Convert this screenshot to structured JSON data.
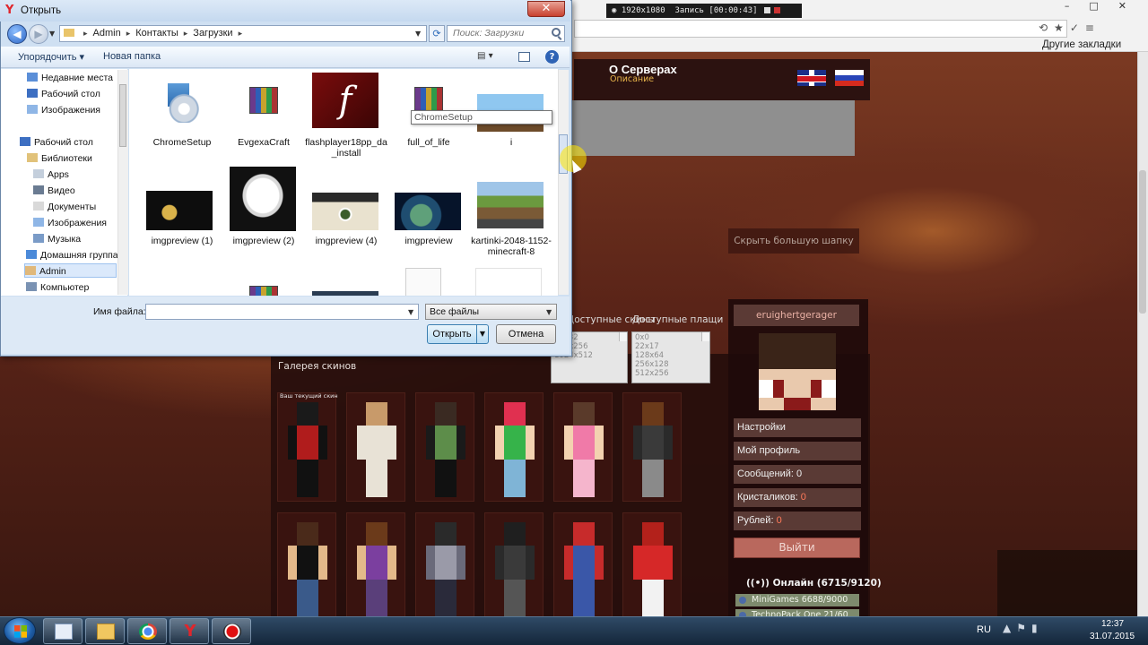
{
  "recorder": {
    "resolution": "1920x1080",
    "status": "Запись [00:00:43]"
  },
  "browser": {
    "other_bookmarks": "Другие закладки"
  },
  "site": {
    "about_title": "О Серверах",
    "about_subtitle": "Описание",
    "hide_header": "Скрыть большую шапку",
    "available_skins": "Доступные скины",
    "available_capes": "Доступные плащи",
    "skin_sizes": [
      "64x32",
      "512x256",
      "1024x512"
    ],
    "cape_sizes": [
      "0x0",
      "22x17",
      "128x64",
      "256x128",
      "512x256"
    ],
    "gallery_title": "Галерея скинов",
    "current_skin_label": "Ваш текущий скин",
    "skins": [
      {
        "name": "skin-1",
        "head": "#1a1a1a",
        "torso": "#b01c1c",
        "arms": "#111111",
        "legs": "#111111"
      },
      {
        "name": "skin-2",
        "head": "#c89a6a",
        "torso": "#e8e2d6",
        "arms": "#e8e2d6",
        "legs": "#e8e2d6"
      },
      {
        "name": "skin-3",
        "head": "#3a2a22",
        "torso": "#5d8d4a",
        "arms": "#1a1a1a",
        "legs": "#111111"
      },
      {
        "name": "skin-4",
        "head": "#e03050",
        "torso": "#36b34a",
        "arms": "#f3d2b0",
        "legs": "#7fb4d6"
      },
      {
        "name": "skin-5",
        "head": "#5a3a2a",
        "torso": "#f07aa8",
        "arms": "#f3d2b0",
        "legs": "#f5b5cc"
      },
      {
        "name": "skin-6",
        "head": "#6b3a1a",
        "torso": "#3a3a3a",
        "arms": "#2a2a2a",
        "legs": "#8a8a8a"
      },
      {
        "name": "skin-7",
        "head": "#4a2a1a",
        "torso": "#111111",
        "arms": "#e3b98a",
        "legs": "#3a5a8a"
      },
      {
        "name": "skin-8",
        "head": "#6b3a1a",
        "torso": "#7b3f9f",
        "arms": "#e3b98a",
        "legs": "#5a3f7a"
      },
      {
        "name": "skin-9",
        "head": "#2a2a2a",
        "torso": "#9a9aa8",
        "arms": "#6a6a7a",
        "legs": "#2a2a3a"
      },
      {
        "name": "skin-10",
        "head": "#1f1f1f",
        "torso": "#3a3a3a",
        "arms": "#2a2a2a",
        "legs": "#555555"
      },
      {
        "name": "skin-11",
        "head": "#c72b2b",
        "torso": "#3a57a8",
        "arms": "#c72b2b",
        "legs": "#3a57a8"
      },
      {
        "name": "skin-12",
        "head": "#b3211b",
        "torso": "#d62828",
        "arms": "#d62828",
        "legs": "#f2f2f2"
      }
    ],
    "profile": {
      "username": "eruighertgerager",
      "menu": [
        "Настройки",
        "Мой профиль"
      ],
      "messages_label": "Сообщений:",
      "messages_value": "0",
      "crystals_label": "Кристаликов:",
      "crystals_value": "0",
      "rubles_label": "Рублей:",
      "rubles_value": "0",
      "logout": "Выйти",
      "online": "Онлайн (6715/9120)",
      "servers": [
        "MiniGames 6688/9000",
        "TechnoPack One 21/60"
      ]
    }
  },
  "dialog": {
    "title": "Открыть",
    "breadcrumb": [
      "Admin",
      "Контакты",
      "Загрузки"
    ],
    "search_placeholder": "Поиск: Загрузки",
    "organize": "Упорядочить ▾",
    "new_folder": "Новая папка",
    "nav": {
      "recent": "Недавние места",
      "desktop1": "Рабочий стол",
      "images1": "Изображения",
      "desktop2": "Рабочий стол",
      "libraries": "Библиотеки",
      "apps": "Apps",
      "video": "Видео",
      "documents": "Документы",
      "images2": "Изображения",
      "music": "Музыка",
      "homegroup": "Домашняя группа",
      "admin": "Admin",
      "computer": "Компьютер"
    },
    "files": [
      {
        "label": "ChromeSetup"
      },
      {
        "label": "EvgexaCraft"
      },
      {
        "label": "flashplayer18pp_da_install"
      },
      {
        "label": "full_of_life"
      },
      {
        "label": "i"
      },
      {
        "label": "imgpreview (1)"
      },
      {
        "label": "imgpreview (2)"
      },
      {
        "label": "imgpreview (4)"
      },
      {
        "label": "imgpreview"
      },
      {
        "label": "kartinki-2048-1152-minecraft-8"
      }
    ],
    "tooltip": "ChromeSetup",
    "filename_label": "Имя файла:",
    "filename_value": "",
    "filetype": "Все файлы",
    "open": "Открыть",
    "cancel": "Отмена"
  },
  "taskbar": {
    "lang": "RU",
    "time": "12:37",
    "date": "31.07.2015"
  }
}
